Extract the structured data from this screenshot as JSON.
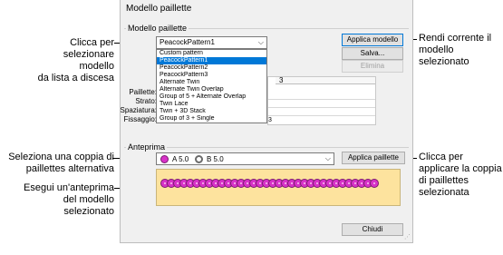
{
  "dialog": {
    "title": "Modello paillette",
    "pattern_group_label": "Modello paillette",
    "preview_group_label": "Anteprima",
    "selected_pattern": "PeacockPattern1",
    "buttons": {
      "apply_pattern": "Applica modello",
      "save": "Salva...",
      "delete": "Elimina",
      "apply_sequins": "Applica paillette",
      "close": "Chiudi"
    },
    "table": {
      "col3_header": "3",
      "row_labels": [
        "Paillette:",
        "Strato:",
        "Spaziatura:",
        "Fissaggio:"
      ],
      "partial_value": "3"
    },
    "dropdown_options": [
      "Custom pattern",
      "PeacockPattern1",
      "PeacockPattern2",
      "PeacockPattern3",
      "Alternate Twin",
      "Alternate Twin Overlap",
      "Group of 5 + Alternate Overlap",
      "Twin Lace",
      "Twin + 3D Stack",
      "Group of 3 + Single"
    ],
    "selected_option_index": 1,
    "sequin_pair": {
      "a_label": "A 5.0",
      "b_label": "B 5.0"
    },
    "preview_sequin_count": 34
  },
  "callouts": {
    "select_pattern": "Clicca per\nselezionare modello\nda lista a discesa",
    "make_current": "Rendi corrente il\nmodello\nselezionato",
    "select_pair": "Seleziona una coppia di\npaillettes alternativa",
    "apply_pair": "Clicca per\napplicare la coppia\ndi paillettes\nselezionata",
    "run_preview": "Esegui un'anteprima\ndel modello\nselezionato"
  },
  "colors": {
    "sequin_a": "#d832c8",
    "sequin_b": "#6a6a6a",
    "preview_bg": "#fde39e",
    "selection": "#0078d7"
  }
}
